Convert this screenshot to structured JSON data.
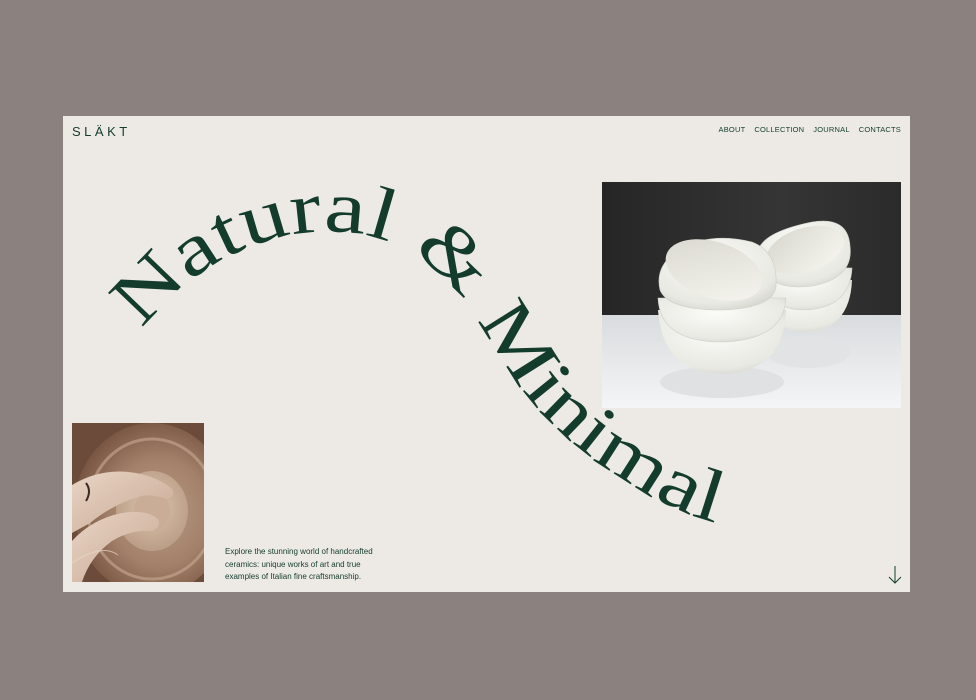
{
  "brand": {
    "logo": "SLÄKT"
  },
  "nav": {
    "items": [
      {
        "label": "ABOUT"
      },
      {
        "label": "COLLECTION"
      },
      {
        "label": "JOURNAL"
      },
      {
        "label": "CONTACTS"
      }
    ]
  },
  "hero": {
    "headline": "Natural & Minimal",
    "intro_line1": "Explore the stunning world of handcrafted",
    "intro_line2": "ceramics: unique works of art and true",
    "intro_line3": "examples of Italian fine craftsmanship."
  },
  "colors": {
    "outer_bg": "#8b817f",
    "page_bg": "#edeae6",
    "accent_green": "#143c2c"
  },
  "icons": {
    "scroll": "arrow-down-icon"
  }
}
